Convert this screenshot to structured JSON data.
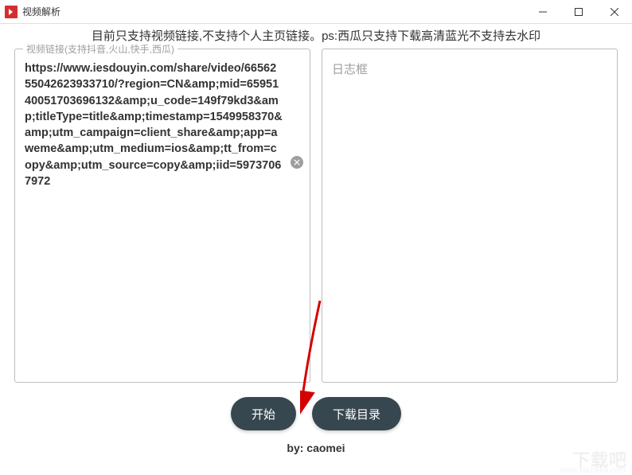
{
  "titlebar": {
    "title": "视频解析"
  },
  "hint": "目前只支持视频链接,不支持个人主页链接。ps:西瓜只支持下载高清蓝光不支持去水印",
  "input_panel": {
    "label": "视频链接(支持抖音,火山,快手,西瓜)",
    "value": "https://www.iesdouyin.com/share/video/6656255042623933710/?region=CN&amp;mid=6595140051703696132&amp;u_code=149f79kd3&amp;titleType=title&amp;timestamp=1549958370&amp;utm_campaign=client_share&amp;app=aweme&amp;utm_medium=ios&amp;tt_from=copy&amp;utm_source=copy&amp;iid=59737067972"
  },
  "log_panel": {
    "placeholder": "日志框"
  },
  "buttons": {
    "start": "开始",
    "download_dir": "下载目录"
  },
  "footer": "by: caomei",
  "watermark": {
    "main": "下载吧",
    "sub": "www.xiazaiba.com"
  }
}
